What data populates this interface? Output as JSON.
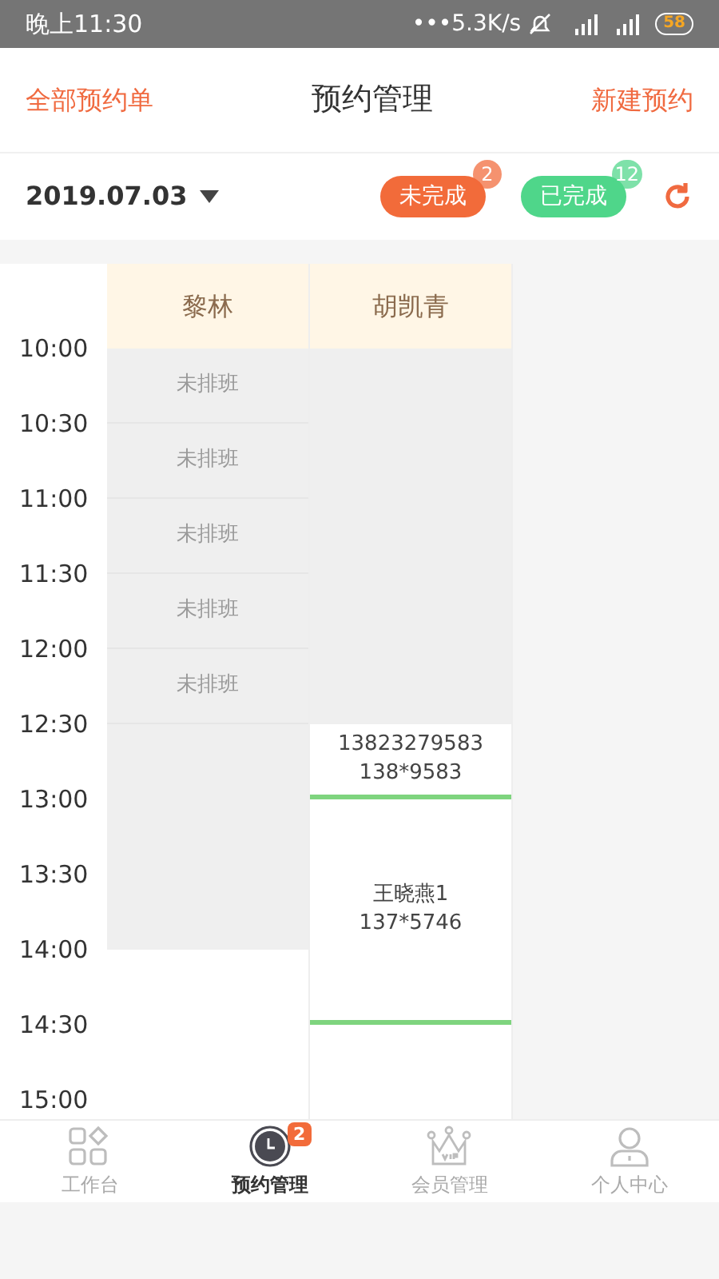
{
  "status_bar": {
    "time": "晚上11:30",
    "speed": "•••5.3K/s",
    "battery": "58"
  },
  "header": {
    "left": "全部预约单",
    "title": "预约管理",
    "right": "新建预约"
  },
  "toolbar": {
    "date": "2019.07.03",
    "filters": [
      {
        "label": "未完成",
        "count": "2",
        "color": "#f26b3a"
      },
      {
        "label": "已完成",
        "count": "12",
        "color": "#4fd68a"
      }
    ]
  },
  "times": [
    "10:00",
    "10:30",
    "11:00",
    "11:30",
    "12:00",
    "12:30",
    "13:00",
    "13:30",
    "14:00",
    "14:30",
    "15:00"
  ],
  "staff": [
    {
      "name": "黎林",
      "slots": [
        {
          "kind": "unscheduled",
          "text": "未排班"
        },
        {
          "kind": "unscheduled",
          "text": "未排班"
        },
        {
          "kind": "unscheduled",
          "text": "未排班"
        },
        {
          "kind": "unscheduled",
          "text": "未排班"
        },
        {
          "kind": "unscheduled",
          "text": "未排班"
        },
        {
          "kind": "unavailable"
        },
        {
          "kind": "continued"
        },
        {
          "kind": "continued"
        }
      ]
    },
    {
      "name": "胡凯青",
      "slots": [
        {
          "kind": "unavailable"
        },
        {
          "kind": "continued"
        },
        {
          "kind": "continued"
        },
        {
          "kind": "continued"
        },
        {
          "kind": "continued"
        },
        {
          "kind": "appointment",
          "lines": [
            "13823279583",
            "138*9583"
          ]
        },
        {
          "kind": "appointment",
          "lines": [
            "王晓燕1",
            "137*5746"
          ]
        },
        {
          "kind": "continued"
        },
        {
          "kind": "continued"
        }
      ]
    }
  ],
  "tabs": [
    {
      "label": "工作台",
      "selected": false
    },
    {
      "label": "预约管理",
      "selected": true,
      "badge": "2"
    },
    {
      "label": "会员管理",
      "selected": false
    },
    {
      "label": "个人中心",
      "selected": false
    }
  ]
}
